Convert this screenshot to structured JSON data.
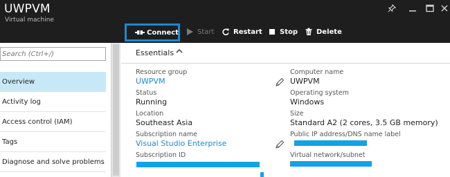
{
  "header": {
    "title": "UWPVM",
    "subtitle": "Virtual machine"
  },
  "toolbar": {
    "connect_label": "Connect",
    "start_label": "Start",
    "restart_label": "Restart",
    "stop_label": "Stop",
    "delete_label": "Delete"
  },
  "window_controls": {
    "pin": "pin-icon",
    "minimize": "minimize-icon",
    "maximize": "maximize-icon",
    "close": "close-icon"
  },
  "search": {
    "placeholder": "Search (Ctrl+/)"
  },
  "nav": {
    "items": [
      {
        "label": "Overview",
        "active": true
      },
      {
        "label": "Activity log",
        "active": false
      },
      {
        "label": "Access control (IAM)",
        "active": false
      },
      {
        "label": "Tags",
        "active": false
      },
      {
        "label": "Diagnose and solve problems",
        "active": false
      }
    ]
  },
  "essentials": {
    "title": "Essentials",
    "left": {
      "resource_group_label": "Resource group",
      "resource_group_value": "UWPVM",
      "status_label": "Status",
      "status_value": "Running",
      "location_label": "Location",
      "location_value": "Southeast Asia",
      "subscription_name_label": "Subscription name",
      "subscription_name_value": "Visual Studio Enterprise",
      "subscription_id_label": "Subscription ID"
    },
    "right": {
      "computer_name_label": "Computer name",
      "computer_name_value": "UWPVM",
      "os_label": "Operating system",
      "os_value": "Windows",
      "size_label": "Size",
      "size_value": "Standard A2 (2 cores, 3.5 GB memory)",
      "public_ip_label": "Public IP address/DNS name label",
      "vnet_label": "Virtual network/subnet"
    }
  },
  "colors": {
    "accent": "#1a8ad4",
    "header_bg": "#1e1e1e",
    "nav_active_bg": "#c7e8f6",
    "redaction": "#12a2e6"
  }
}
